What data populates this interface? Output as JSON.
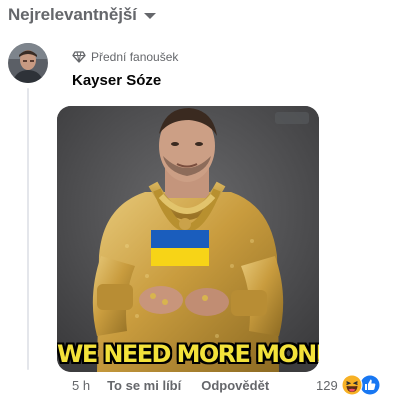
{
  "sort": {
    "label": "Nejrelevantnější",
    "icon": "chevron-down-icon"
  },
  "comment": {
    "badge": {
      "icon": "diamond-icon",
      "label": "Přední fanoušek"
    },
    "author": "Kayser Sóze",
    "image_caption": "WE NEED MORE MONEY",
    "timestamp": "5 h",
    "like_label": "To se mi líbí",
    "reply_label": "Odpovědět",
    "reactions": {
      "count": "129",
      "icons": [
        "haha-reaction-icon",
        "like-reaction-icon"
      ]
    }
  },
  "colors": {
    "muted": "#65676b",
    "caption_yellow": "#f3e23a",
    "like_blue": "#1877f2",
    "haha_yellow": "#f7b125"
  }
}
